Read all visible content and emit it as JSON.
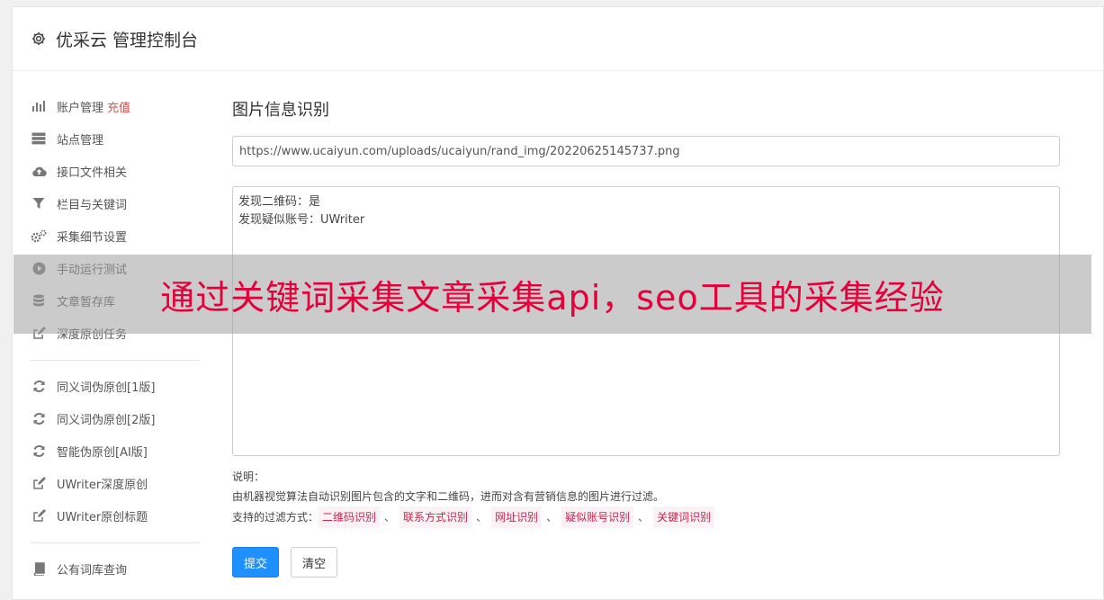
{
  "header": {
    "title": "优采云 管理控制台",
    "icon": "gear-icon"
  },
  "sidebar": {
    "groups": [
      [
        {
          "label": "账户管理",
          "extra": "充值",
          "icon": "bar-chart-icon"
        },
        {
          "label": "站点管理",
          "icon": "server-icon"
        },
        {
          "label": "接口文件相关",
          "icon": "cloud-upload-icon"
        },
        {
          "label": "栏目与关键词",
          "icon": "filter-icon"
        },
        {
          "label": "采集细节设置",
          "icon": "gears-icon"
        },
        {
          "label": "手动运行测试",
          "icon": "play-circle-icon"
        },
        {
          "label": "文章暂存库",
          "icon": "database-icon"
        },
        {
          "label": "深度原创任务",
          "icon": "edit-icon"
        }
      ],
      [
        {
          "label": "同义词伪原创[1版]",
          "icon": "refresh-icon"
        },
        {
          "label": "同义词伪原创[2版]",
          "icon": "refresh-icon"
        },
        {
          "label": "智能伪原创[AI版]",
          "icon": "refresh-icon"
        },
        {
          "label": "UWriter深度原创",
          "icon": "edit-icon"
        },
        {
          "label": "UWriter原创标题",
          "icon": "edit-icon"
        }
      ],
      [
        {
          "label": "公有词库查询",
          "icon": "book-icon"
        }
      ]
    ]
  },
  "main": {
    "title": "图片信息识别",
    "url_value": "https://www.ucaiyun.com/uploads/ucaiyun/rand_img/20220625145737.png",
    "result_lines": [
      "发现二维码：是",
      "发现疑似账号：UWriter"
    ],
    "note_title": "说明：",
    "note_desc": "由机器视觉算法自动识别图片包含的文字和二维码，进而对含有营销信息的图片进行过滤。",
    "filter_label": "支持的过滤方式：",
    "filters": [
      "二维码识别",
      "联系方式识别",
      "网址识别",
      "疑似账号识别",
      "关键词识别"
    ],
    "separator": "、",
    "submit_label": "提交",
    "clear_label": "清空"
  },
  "overlay": {
    "text": "通过关键词采集文章采集api，seo工具的采集经验"
  },
  "colors": {
    "accent": "#1e90ff",
    "tag_text": "#c7254e",
    "overlay_text": "#e6003a",
    "recharge": "#d9534f"
  }
}
